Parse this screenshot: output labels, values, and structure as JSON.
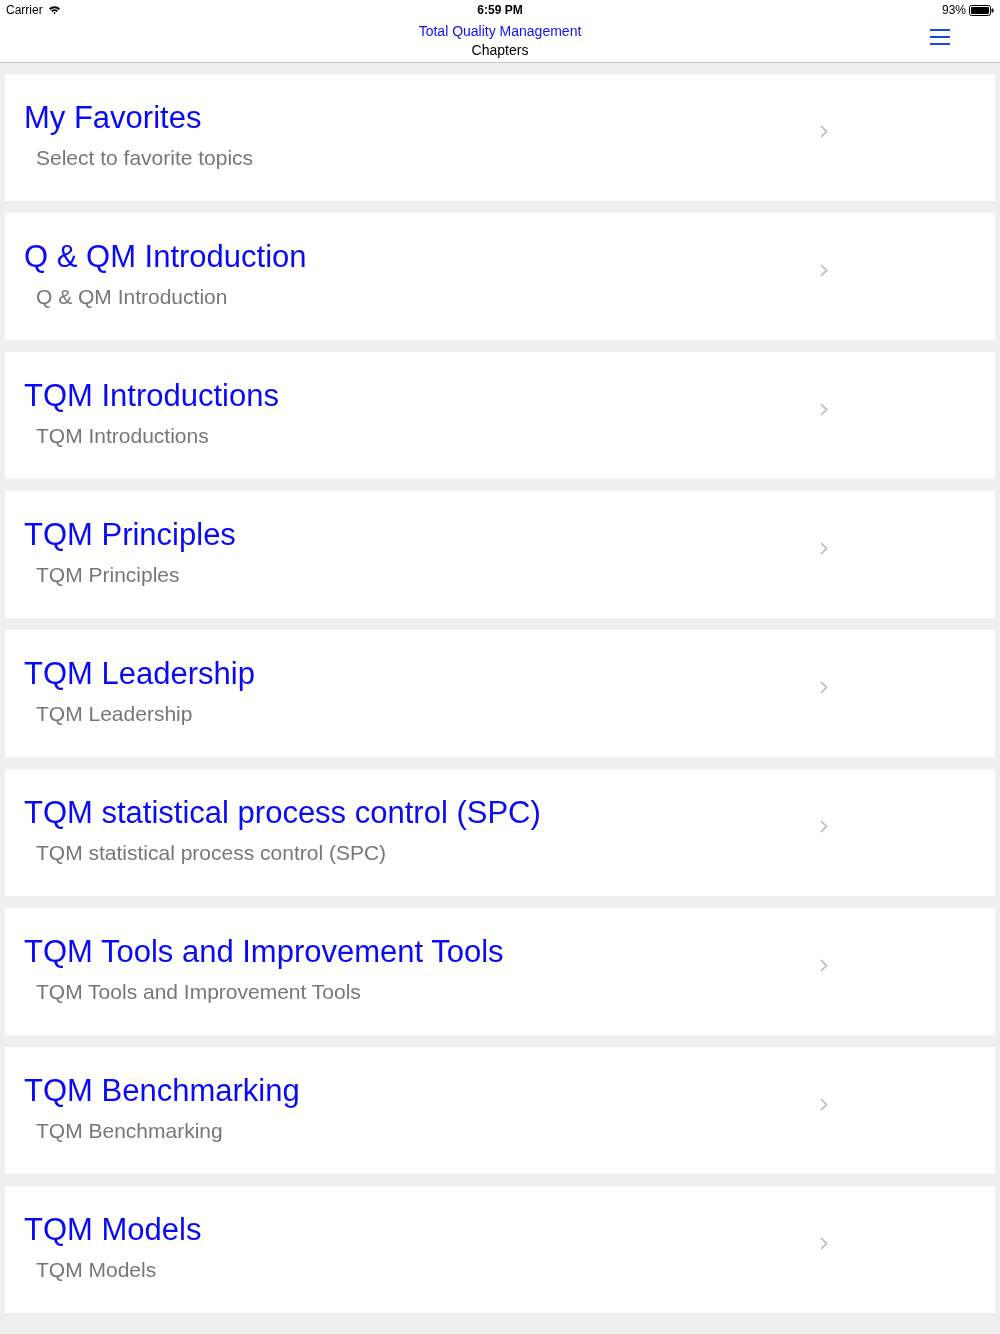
{
  "status_bar": {
    "carrier": "Carrier",
    "time": "6:59 PM",
    "battery": "93%"
  },
  "nav": {
    "title": "Total Quality Management",
    "subtitle": "Chapters"
  },
  "chapters": [
    {
      "title": "My Favorites",
      "subtitle": "Select to favorite topics"
    },
    {
      "title": "Q & QM Introduction",
      "subtitle": "Q & QM Introduction"
    },
    {
      "title": "TQM Introductions",
      "subtitle": "TQM Introductions"
    },
    {
      "title": "TQM Principles",
      "subtitle": "TQM Principles"
    },
    {
      "title": "TQM Leadership",
      "subtitle": "TQM Leadership"
    },
    {
      "title": "TQM statistical process control (SPC)",
      "subtitle": "TQM statistical process control (SPC)"
    },
    {
      "title": "TQM Tools and Improvement Tools",
      "subtitle": "TQM Tools and Improvement Tools"
    },
    {
      "title": "TQM Benchmarking",
      "subtitle": "TQM Benchmarking"
    },
    {
      "title": "TQM Models",
      "subtitle": "TQM Models"
    }
  ]
}
